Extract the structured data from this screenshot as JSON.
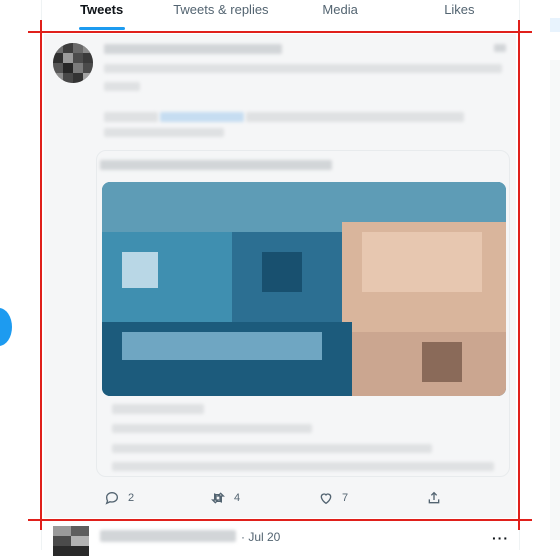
{
  "tabs": [
    {
      "label": "Tweets",
      "active": true
    },
    {
      "label": "Tweets & replies",
      "active": false
    },
    {
      "label": "Media",
      "active": false
    },
    {
      "label": "Likes",
      "active": false
    }
  ],
  "tweet": {
    "actions": {
      "reply_count": "2",
      "retweet_count": "4",
      "like_count": "7"
    }
  },
  "next_tweet": {
    "date": "· Jul 20",
    "more_label": "···"
  },
  "colors": {
    "accent": "#1d9bf0",
    "annotation": "#e0201b",
    "muted_text": "#536471"
  },
  "icons": [
    "reply-icon",
    "retweet-icon",
    "like-icon",
    "share-icon",
    "more-icon"
  ]
}
